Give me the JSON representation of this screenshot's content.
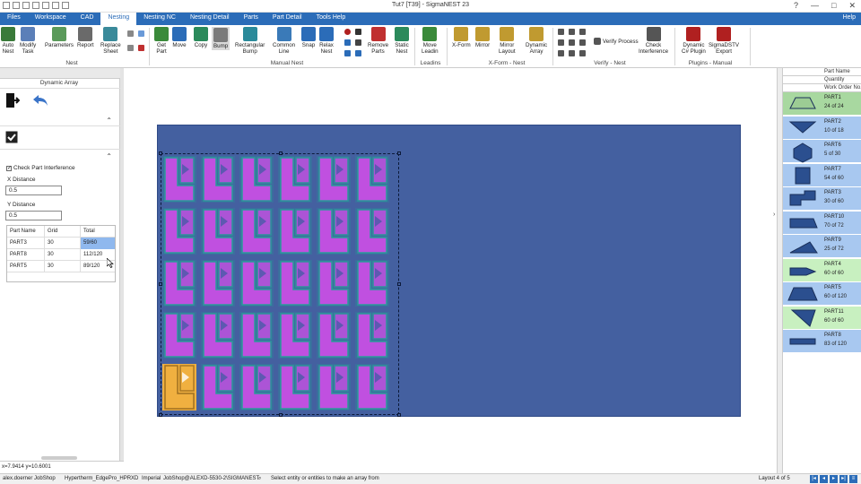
{
  "window": {
    "title": "Tut7 [T39] - SigmaNEST 23",
    "controls": [
      "?",
      "—",
      "□",
      "✕"
    ]
  },
  "menu": {
    "items": [
      "Files",
      "Workspace",
      "CAD",
      "Nesting",
      "Nesting NC",
      "Nesting Detail",
      "Parts",
      "Part Detail",
      "Tools Help"
    ],
    "active": "Nesting",
    "help": "Help"
  },
  "ribbon": {
    "buttons": [
      {
        "label": "Auto\nNest",
        "icon": "auto-nest-icon",
        "color": "#3a7a3a"
      },
      {
        "label": "Modify\nTask",
        "icon": "modify-task-icon",
        "color": "#5b7fb8"
      },
      {
        "label": "Parameters",
        "icon": "parameters-icon",
        "color": "#5a9a5a"
      },
      {
        "label": "Report",
        "icon": "report-icon",
        "color": "#6a6a6a"
      },
      {
        "label": "Replace\nSheet",
        "icon": "replace-sheet-icon",
        "color": "#3a8a9a"
      },
      {
        "label": "Get\nPart",
        "icon": "get-part-icon",
        "color": "#3a8a3a"
      },
      {
        "label": "Move",
        "icon": "move-icon",
        "color": "#2b6cb8"
      },
      {
        "label": "Copy",
        "icon": "copy-icon",
        "color": "#2b8a5b"
      },
      {
        "label": "Bump",
        "icon": "bump-icon",
        "color": "#7a7a7a"
      },
      {
        "label": "Rectangular\nBump",
        "icon": "rectangular-bump-icon",
        "color": "#2b8a9a"
      },
      {
        "label": "Common\nLine",
        "icon": "common-line-icon",
        "color": "#3a7ab8"
      },
      {
        "label": "Snap",
        "icon": "snap-icon",
        "color": "#2b6cb8"
      },
      {
        "label": "Relax\nNest",
        "icon": "relax-nest-icon",
        "color": "#2b6cb8"
      },
      {
        "label": "Remove\nParts",
        "icon": "remove-parts-icon",
        "color": "#c03030"
      },
      {
        "label": "Static\nNest",
        "icon": "static-nest-icon",
        "color": "#2b8a5b"
      },
      {
        "label": "Move\nLeadin",
        "icon": "move-leadin-icon",
        "color": "#3a8a3a"
      },
      {
        "label": "X-Form",
        "icon": "x-form-icon",
        "color": "#c09a30"
      },
      {
        "label": "Mirror",
        "icon": "mirror-icon",
        "color": "#c09a30"
      },
      {
        "label": "Mirror\nLayout",
        "icon": "mirror-layout-icon",
        "color": "#c09a30"
      },
      {
        "label": "Dynamic\nArray",
        "icon": "dynamic-array-icon",
        "color": "#c09a30"
      },
      {
        "label": "Verify Process",
        "icon": "verify-process-icon",
        "color": "#555"
      },
      {
        "label": "Check\nInterference",
        "icon": "check-interference-icon",
        "color": "#555"
      },
      {
        "label": "Dynamic\nC# Plugin",
        "icon": "dynamic-csharp-plugin-icon",
        "color": "#b02020"
      },
      {
        "label": "SigmaDSTV\nExport",
        "icon": "sigmadstv-export-icon",
        "color": "#b02020"
      }
    ],
    "groups": [
      "Nest",
      "Manual Nest",
      "Leadins",
      "X-Form - Nest",
      "Verify - Nest",
      "Plugins - Manual"
    ]
  },
  "left_panel": {
    "title": "Dynamic Array",
    "check_part_interference": "Check Part Interference",
    "x_label": "X Distance",
    "x_value": "0.5",
    "y_label": "Y Distance",
    "y_value": "0.5",
    "table": {
      "headers": [
        "Part Name",
        "Grid",
        "Total"
      ],
      "rows": [
        [
          "PART3",
          "30",
          "59/60"
        ],
        [
          "PART8",
          "30",
          "112/120"
        ],
        [
          "PART5",
          "30",
          "89/120"
        ]
      ]
    }
  },
  "coords": "x=7.9414 y=10.6001",
  "right_panel": {
    "headers": [
      "Part Name",
      "Quantity",
      "Work Order No."
    ],
    "parts": [
      {
        "name": "PART1",
        "qty": "24 of 24",
        "bg": "#a8d8a0"
      },
      {
        "name": "PART2",
        "qty": "10 of 18",
        "bg": "#a8c8f0"
      },
      {
        "name": "PART6",
        "qty": "5 of 30",
        "bg": "#a8c8f0"
      },
      {
        "name": "PART7",
        "qty": "54 of 60",
        "bg": "#a8c8f0"
      },
      {
        "name": "PART3",
        "qty": "30 of 60",
        "bg": "#a8c8f0"
      },
      {
        "name": "PART10",
        "qty": "70 of 72",
        "bg": "#a8c8f0"
      },
      {
        "name": "PART9",
        "qty": "25 of 72",
        "bg": "#a8c8f0"
      },
      {
        "name": "PART4",
        "qty": "60 of 60",
        "bg": "#c8f0c0"
      },
      {
        "name": "PART5",
        "qty": "60 of 120",
        "bg": "#a8c8f0"
      },
      {
        "name": "PART11",
        "qty": "60 of 60",
        "bg": "#c8f0c0"
      },
      {
        "name": "PART8",
        "qty": "83 of 120",
        "bg": "#a8c8f0"
      }
    ]
  },
  "status": {
    "user": "alex.doerner JobShop",
    "machine": "Hypertherm_EdgePro_HPRXD",
    "units": "Imperial",
    "db": "JobShop@ALEXD-5530-2\\SIGMANEST",
    "message": "Select entity or entities to make an array from",
    "layout": "Layout 4 of 5"
  }
}
